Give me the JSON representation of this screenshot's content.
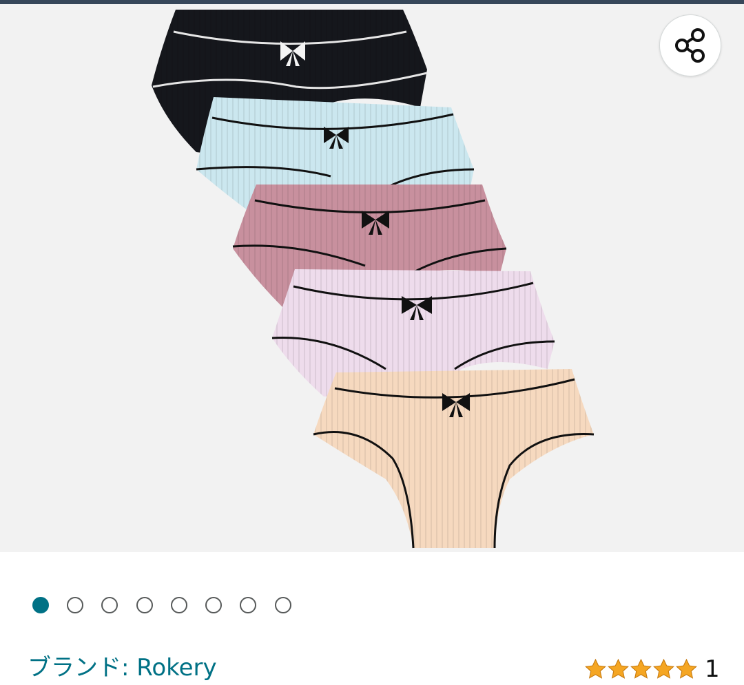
{
  "gallery": {
    "image_description_icon": "product-photo",
    "page_count": 8,
    "active_index": 0
  },
  "share": {
    "icon": "share-icon"
  },
  "brand": {
    "label": "ブランド: Rokery"
  },
  "rating": {
    "stars": 5,
    "count": "1",
    "color": "#f5a623"
  },
  "colors": {
    "accent": "#007185",
    "text": "#0f1111"
  }
}
